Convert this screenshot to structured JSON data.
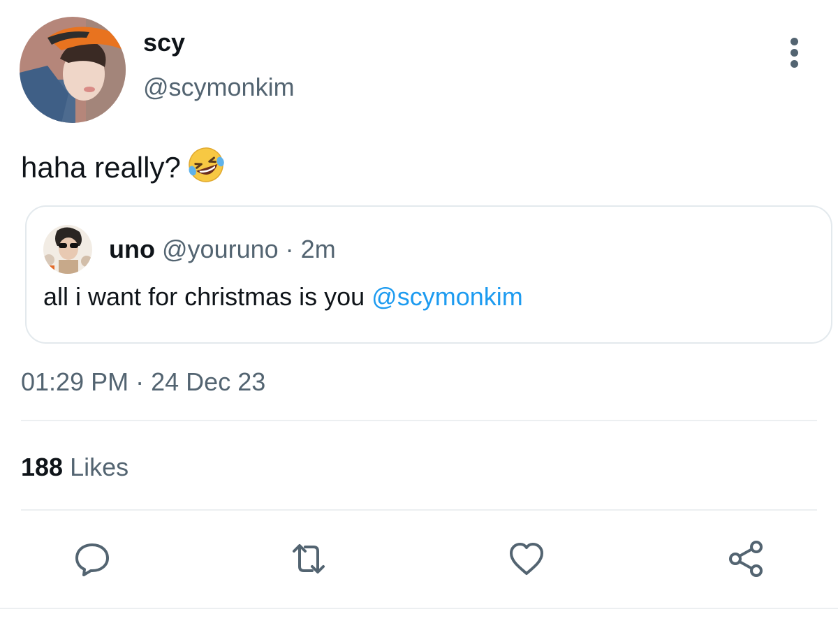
{
  "author": {
    "display_name": "scy",
    "handle": "@scymonkim"
  },
  "tweet": {
    "text": "haha really?",
    "emoji": "rolling-on-the-floor-laughing"
  },
  "quoted_tweet": {
    "display_name": "uno",
    "handle": "@youruno",
    "separator": "·",
    "time_ago": "2m",
    "text": "all i want for christmas is you",
    "mention": "@scymonkim"
  },
  "meta": {
    "time": "01:29 PM",
    "separator": "·",
    "date": "24 Dec 23"
  },
  "stats": {
    "likes_count": "188",
    "likes_label": "Likes"
  },
  "actions": [
    {
      "name": "reply",
      "icon": "reply-icon"
    },
    {
      "name": "retweet",
      "icon": "retweet-icon"
    },
    {
      "name": "like",
      "icon": "heart-icon"
    },
    {
      "name": "share",
      "icon": "share-icon"
    }
  ],
  "colors": {
    "text_primary": "#0f1419",
    "text_secondary": "#536471",
    "link": "#1d9bf0",
    "border": "#e3e9ed"
  }
}
